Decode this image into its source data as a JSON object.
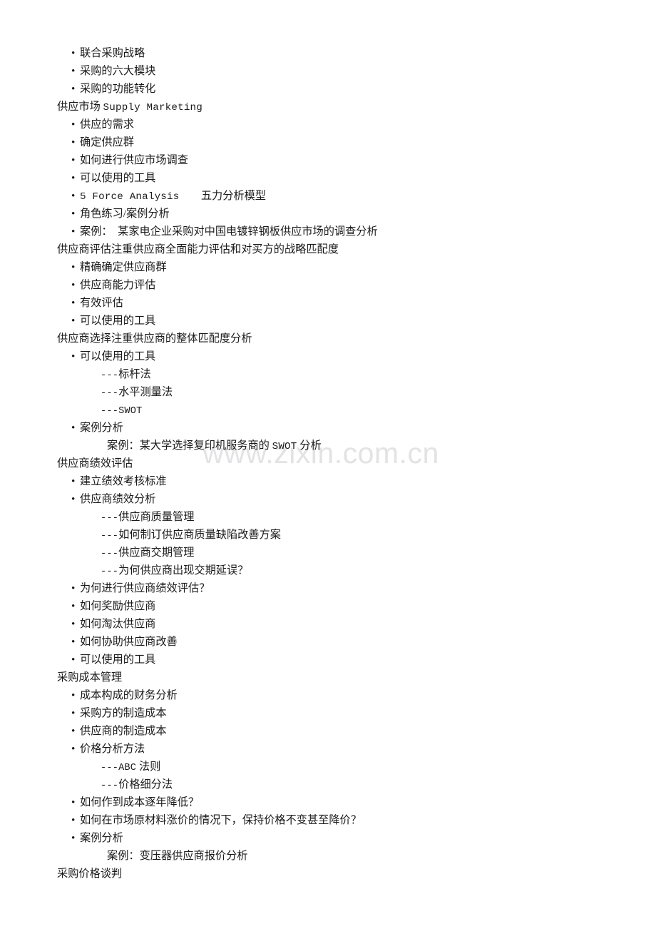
{
  "page": {
    "background_color": "#ffffff",
    "text_color": "#1a1a1a"
  },
  "watermark": {
    "text": "www.zixin.com.cn",
    "color": "#e3e3e5"
  },
  "bullet_mark": "•",
  "lines": [
    {
      "type": "bullet",
      "text": "联合采购战略"
    },
    {
      "type": "bullet",
      "text": "采购的六大模块"
    },
    {
      "type": "bullet",
      "text": "采购的功能转化"
    },
    {
      "type": "heading",
      "text": "供应市场 ",
      "latin": "Supply Marketing",
      "tail": ""
    },
    {
      "type": "bullet",
      "text": "供应的需求"
    },
    {
      "type": "bullet",
      "text": "确定供应群"
    },
    {
      "type": "bullet",
      "text": "如何进行供应市场调查"
    },
    {
      "type": "bullet",
      "text": "可以使用的工具"
    },
    {
      "type": "bullet",
      "text": "",
      "latin": "5 Force Analysis",
      "tail": "　　五力分析模型"
    },
    {
      "type": "bullet",
      "text": "角色练习/案例分析"
    },
    {
      "type": "bullet",
      "text": "案例：　某家电企业采购对中国电镀锌钢板供应市场的调查分析"
    },
    {
      "type": "heading",
      "text": "供应商评估注重供应商全面能力评估和对买方的战略匹配度"
    },
    {
      "type": "bullet",
      "text": "精确确定供应商群"
    },
    {
      "type": "bullet",
      "text": "供应商能力评估"
    },
    {
      "type": "bullet",
      "text": "有效评估"
    },
    {
      "type": "bullet",
      "text": "可以使用的工具"
    },
    {
      "type": "heading",
      "text": "供应商选择注重供应商的整体匹配度分析"
    },
    {
      "type": "bullet",
      "text": "可以使用的工具"
    },
    {
      "type": "dash",
      "text": "",
      "latin": "---",
      "tail": "标杆法"
    },
    {
      "type": "dash",
      "text": "",
      "latin": "---",
      "tail": "水平测量法"
    },
    {
      "type": "dash",
      "text": "",
      "latin": "---SWOT",
      "tail": ""
    },
    {
      "type": "bullet",
      "text": "案例分析"
    },
    {
      "type": "case",
      "text": "案例：某大学选择复印机服务商的 ",
      "latin": "SWOT",
      "tail": " 分析"
    },
    {
      "type": "heading",
      "text": "供应商绩效评估"
    },
    {
      "type": "bullet",
      "text": "建立绩效考核标准"
    },
    {
      "type": "bullet",
      "text": "供应商绩效分析"
    },
    {
      "type": "dash",
      "text": "",
      "latin": "---",
      "tail": "供应商质量管理"
    },
    {
      "type": "dash",
      "text": "",
      "latin": "---",
      "tail": "如何制订供应商质量缺陷改善方案"
    },
    {
      "type": "dash",
      "text": "",
      "latin": "---",
      "tail": "供应商交期管理"
    },
    {
      "type": "dash",
      "text": "",
      "latin": "---",
      "tail": "为何供应商出现交期延误？"
    },
    {
      "type": "bullet",
      "text": "为何进行供应商绩效评估？"
    },
    {
      "type": "bullet",
      "text": "如何奖励供应商"
    },
    {
      "type": "bullet",
      "text": "如何淘汰供应商"
    },
    {
      "type": "bullet",
      "text": "如何协助供应商改善"
    },
    {
      "type": "bullet",
      "text": "可以使用的工具"
    },
    {
      "type": "heading",
      "text": "采购成本管理"
    },
    {
      "type": "bullet",
      "text": "成本构成的财务分析"
    },
    {
      "type": "bullet",
      "text": "采购方的制造成本"
    },
    {
      "type": "bullet",
      "text": "供应商的制造成本"
    },
    {
      "type": "bullet",
      "text": "价格分析方法"
    },
    {
      "type": "dash",
      "text": "",
      "latin": "---ABC",
      "tail": " 法则"
    },
    {
      "type": "dash",
      "text": "",
      "latin": "---",
      "tail": "价格细分法"
    },
    {
      "type": "bullet",
      "text": "如何作到成本逐年降低？"
    },
    {
      "type": "bullet",
      "text": "如何在市场原材料涨价的情况下，保持价格不变甚至降价？"
    },
    {
      "type": "bullet",
      "text": "案例分析"
    },
    {
      "type": "case",
      "text": "案例：变压器供应商报价分析"
    },
    {
      "type": "heading",
      "text": "采购价格谈判"
    }
  ]
}
